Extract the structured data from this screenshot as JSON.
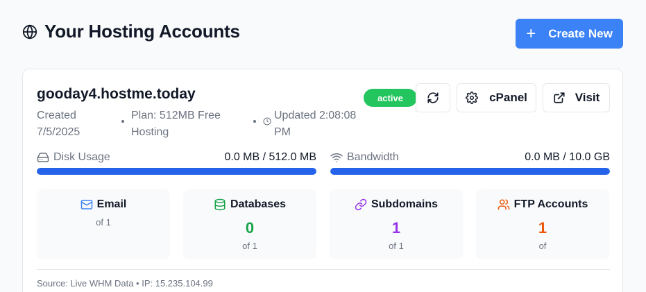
{
  "header": {
    "title": "Your Hosting Accounts",
    "create_label": "Create New",
    "create_icon": "plus-icon",
    "title_icon": "globe-icon"
  },
  "account": {
    "domain": "gooday4.hostme.today",
    "created": "Created 7/5/2025",
    "plan": "Plan: 512MB Free Hosting",
    "updated": "Updated 2:08:08 PM",
    "status": "active",
    "buttons": {
      "refresh_icon": "refresh-icon",
      "cpanel_label": "cPanel",
      "visit_label": "Visit"
    },
    "disk": {
      "label": "Disk Usage",
      "value": "0.0 MB / 512.0 MB",
      "fill_fraction": 1.0
    },
    "bandwidth": {
      "label": "Bandwidth",
      "value": "0.0 MB / 10.0 GB",
      "fill_fraction": 1.0
    },
    "stats": [
      {
        "label": "Email",
        "value": "",
        "sub": "of 1",
        "icon": "mail-icon",
        "color": "#3b82f6"
      },
      {
        "label": "Databases",
        "value": "0",
        "sub": "of 1",
        "icon": "database-icon",
        "color": "#16a34a"
      },
      {
        "label": "Subdomains",
        "value": "1",
        "sub": "of 1",
        "icon": "link-icon",
        "color": "#9333ea"
      },
      {
        "label": "FTP Accounts",
        "value": "1",
        "sub": "of",
        "icon": "users-icon",
        "color": "#ea580c"
      }
    ],
    "footer": "Source: Live WHM Data • IP: 15.235.104.99"
  },
  "colors": {
    "accent": "#3b82f6",
    "active": "#22c55e",
    "bar": "#2563eb"
  }
}
